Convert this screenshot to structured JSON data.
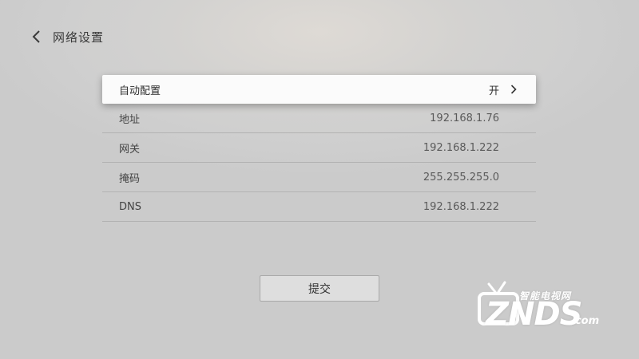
{
  "header": {
    "back_icon": "chevron-left-icon",
    "title": "网络设置"
  },
  "settings": {
    "auto_config": {
      "label": "自动配置",
      "value": "开",
      "icon": "chevron-right-icon"
    },
    "rows": [
      {
        "label": "地址",
        "value": "192.168.1.76"
      },
      {
        "label": "网关",
        "value": "192.168.1.222"
      },
      {
        "label": "掩码",
        "value": "255.255.255.0"
      },
      {
        "label": "DNS",
        "value": "192.168.1.222"
      }
    ]
  },
  "submit": {
    "label": "提交"
  },
  "watermark": {
    "subtitle": "智能电视网",
    "brand": "ZNDS",
    "domain": ".com"
  },
  "colors": {
    "background": "#d0d0d0",
    "selected_row": "#fbfbfb",
    "divider": "#b2b2b2"
  }
}
